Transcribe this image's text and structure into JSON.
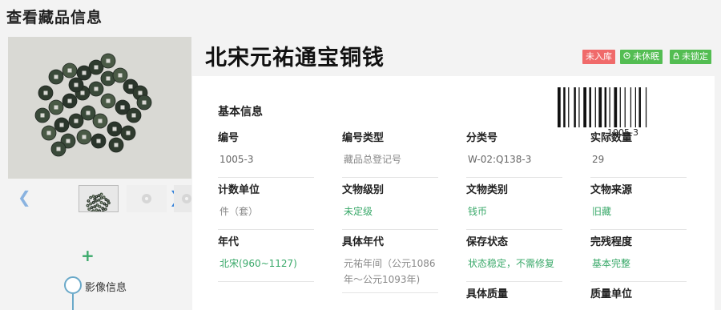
{
  "page": {
    "title": "查看藏品信息"
  },
  "relic": {
    "title": "北宋元祐通宝铜钱",
    "badges": [
      {
        "label": "未入库",
        "color": "#f06a6a"
      },
      {
        "label": "未休眠",
        "color": "#53bd52",
        "icon": "clock-icon"
      },
      {
        "label": "未锁定",
        "color": "#53bd52",
        "icon": "lock-icon"
      }
    ],
    "barcode_text": "1005-3"
  },
  "gallery": {
    "prev_glyph": "❮",
    "next_glyph": "❯",
    "add_glyph": "+",
    "timeline_label": "影像信息"
  },
  "basic_info": {
    "section_title": "基本信息",
    "fields": [
      {
        "label": "编号",
        "value": "1005-3"
      },
      {
        "label": "编号类型",
        "value": "藏品总登记号"
      },
      {
        "label": "分类号",
        "value": "W-02:Q138-3"
      },
      {
        "label": "实际数量",
        "value": "29"
      },
      {
        "label": "计数单位",
        "value": "件（套）"
      },
      {
        "label": "文物级别",
        "value": "未定级"
      },
      {
        "label": "文物类别",
        "value": "钱币"
      },
      {
        "label": "文物来源",
        "value": "旧藏"
      },
      {
        "label": "年代",
        "value": "北宋(960~1127)"
      },
      {
        "label": "具体年代",
        "value": "元祐年间（公元1086年～公元1093年)"
      },
      {
        "label": "保存状态",
        "value": "状态稳定，不需修复"
      },
      {
        "label": "完残程度",
        "value": "基本完整"
      },
      {
        "label": "具体质量",
        "value": ""
      },
      {
        "label": "质量单位",
        "value": ""
      }
    ]
  }
}
